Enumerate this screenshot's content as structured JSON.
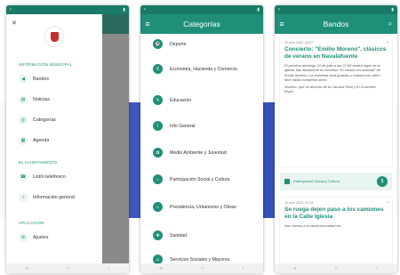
{
  "phone1": {
    "section_info": "INFORMACIÓN MUNICIPAL",
    "items_info": [
      {
        "label": "Bandos",
        "icon": "megaphone-icon"
      },
      {
        "label": "Noticias",
        "icon": "news-icon"
      },
      {
        "label": "Categorías",
        "icon": "categories-icon"
      },
      {
        "label": "Agenda",
        "icon": "calendar-icon"
      }
    ],
    "section_ayto": "EL AYUNTAMIENTO",
    "items_ayto": [
      {
        "label": "Listín telefónico",
        "icon": "phone-icon"
      },
      {
        "label": "Información general",
        "icon": "info-icon"
      }
    ],
    "section_app": "APLICACIÓN",
    "items_app": [
      {
        "label": "Ajustes",
        "icon": "settings-icon"
      }
    ]
  },
  "phone2": {
    "title": "Categorías",
    "categories": [
      "Deporte",
      "Economía, Hacienda y Comercio",
      "Educación",
      "Info General",
      "Medio Ambiente y Juventud",
      "Participación Social y Cultura",
      "Presidencia, Urbanismo y Obras",
      "Sanidad",
      "Servicios Sociales y Mayores"
    ]
  },
  "phone3": {
    "title": "Bandos",
    "card1": {
      "date": "22 julio 2022 16:37",
      "title": "Concierto: \"Emilio Moreno\", clásicos de verano en Navalafuente",
      "body1": "El próximo domingo 24 de julio a las 21:00 tendrá lugar en la iglesia San Bartolomé el concierto \"El músico en soledad\" de Emilio Moreno. La actividad será gratuita y contará con aforo libre hasta completar aforo.",
      "body2": "Moreno, que es director de la Cámara Real y El Concierto Espa..."
    },
    "tag": "Participación Social y Cultura",
    "card2": {
      "date": "22 julio 2022 13:14",
      "title": "Se ruega dejen paso a los camiones en la Calle Iglesia",
      "body": "Nos vemos a la obra/comunidad de..."
    }
  },
  "colors": {
    "primary": "#1f8f79",
    "background_band": "#3550b8"
  }
}
